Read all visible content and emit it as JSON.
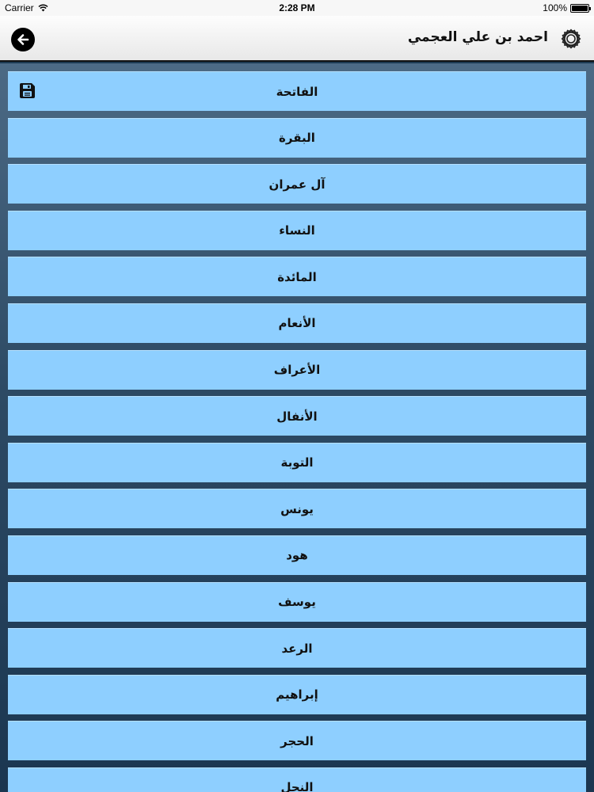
{
  "status_bar": {
    "carrier": "Carrier",
    "time": "2:28 PM",
    "battery": "100%",
    "battery_level": 1.0
  },
  "nav": {
    "title": "احمد بن علي العجمي",
    "back_icon": "arrow-left-icon",
    "settings_icon": "gear-flower-icon"
  },
  "surahs": [
    {
      "label": "الفاتحة",
      "saved": true
    },
    {
      "label": "البقرة"
    },
    {
      "label": "آل عمران"
    },
    {
      "label": "النساء"
    },
    {
      "label": "المائدة"
    },
    {
      "label": "الأنعام"
    },
    {
      "label": "الأعراف"
    },
    {
      "label": "الأنفال"
    },
    {
      "label": "التوبة"
    },
    {
      "label": "يونس"
    },
    {
      "label": "هود"
    },
    {
      "label": "يوسف"
    },
    {
      "label": "الرعد"
    },
    {
      "label": "إبراهيم"
    },
    {
      "label": "الحجر"
    },
    {
      "label": "النحل"
    }
  ],
  "colors": {
    "row_background": "#8ecfff",
    "list_background": "#2d4a64"
  }
}
